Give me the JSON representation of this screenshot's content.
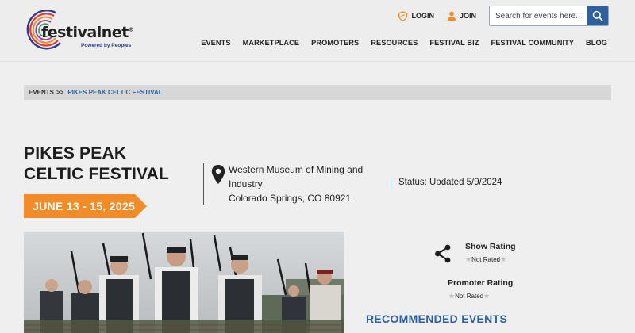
{
  "brand": {
    "logo_word": "festival",
    "logo_word_suffix": "net",
    "tagline": "Powered by Peoples",
    "colors": {
      "accent": "#2e5f9e",
      "orange": "#f28c28"
    }
  },
  "header": {
    "login_label": "LOGIN",
    "join_label": "JOIN",
    "search_placeholder": "Search for events here..",
    "nav": [
      "EVENTS",
      "MARKETPLACE",
      "PROMOTERS",
      "RESOURCES",
      "FESTIVAL BIZ",
      "FESTIVAL COMMUNITY",
      "BLOG"
    ]
  },
  "breadcrumb": {
    "root": "EVENTS",
    "separator": ">>",
    "current": "PIKES PEAK CELTIC FESTIVAL"
  },
  "event": {
    "title_line1": "PIKES PEAK",
    "title_line2": "CELTIC FESTIVAL",
    "dates": "JUNE 13 - 15, 2025",
    "venue_line1": "Western Museum of Mining and",
    "venue_line2": "Industry",
    "venue_line3": "Colorado Springs, CO 80921",
    "status": "Status: Updated 5/9/2024"
  },
  "ratings": {
    "show_title": "Show Rating",
    "show_value": "Not Rated",
    "promoter_title": "Promoter Rating",
    "promoter_value": "Not Rated"
  },
  "recommended_heading": "RECOMMENDED EVENTS",
  "icons": [
    "login-shield-icon",
    "user-icon",
    "search-icon",
    "map-pin-icon",
    "share-icon",
    "star-icon"
  ]
}
